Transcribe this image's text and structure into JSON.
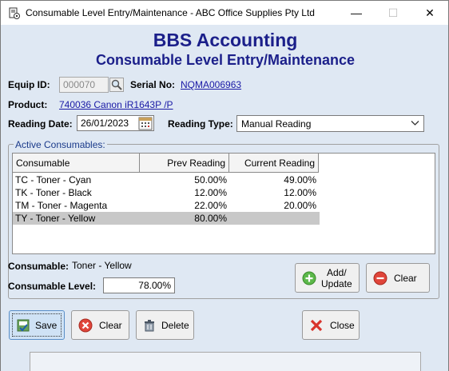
{
  "window": {
    "title": "Consumable Level Entry/Maintenance - ABC Office Supplies Pty Ltd",
    "minimize_glyph": "—",
    "maximize_glyph": "☐",
    "close_glyph": "✕"
  },
  "header": {
    "title": "BBS Accounting",
    "subtitle": "Consumable Level Entry/Maintenance"
  },
  "form": {
    "equip_id_label": "Equip ID:",
    "equip_id_value": "000070",
    "serial_no_label": "Serial No:",
    "serial_no_value": "NQMA006963",
    "product_label": "Product:",
    "product_value": "740036 Canon iR1643P /P",
    "reading_date_label": "Reading Date:",
    "reading_date_value": "26/01/2023",
    "reading_type_label": "Reading Type:",
    "reading_type_value": "Manual Reading"
  },
  "consumables": {
    "group_title": "Active Consumables:",
    "columns": [
      "Consumable",
      "Prev Reading",
      "Current Reading"
    ],
    "rows": [
      {
        "name": "TC - Toner - Cyan",
        "prev": "50.00%",
        "current": "49.00%"
      },
      {
        "name": "TK - Toner - Black",
        "prev": "12.00%",
        "current": "12.00%"
      },
      {
        "name": "TM - Toner - Magenta",
        "prev": "22.00%",
        "current": "20.00%"
      },
      {
        "name": "TY - Toner - Yellow",
        "prev": "80.00%",
        "current": ""
      }
    ],
    "selected_index": 3,
    "consumable_label": "Consumable:",
    "consumable_value": "Toner - Yellow",
    "level_label": "Consumable Level:",
    "level_value": "78.00%",
    "add_update_line1": "Add/",
    "add_update_line2": "Update",
    "clear_label": "Clear"
  },
  "footer": {
    "save_label": "Save",
    "clear_label": "Clear",
    "delete_label": "Delete",
    "close_label": "Close"
  },
  "icons": {
    "app": "document-gear-icon",
    "search": "search-icon",
    "calendar": "calendar-icon",
    "add": "plus-circle-icon",
    "clear": "minus-circle-icon",
    "save": "save-icon",
    "footer_clear": "x-circle-icon",
    "delete": "delete-icon",
    "close": "close-x-icon"
  },
  "colors": {
    "header_text": "#1b1f8a",
    "link": "#1a1aa6",
    "background": "#dfe8f3",
    "selected_row": "#c8c8c8"
  }
}
